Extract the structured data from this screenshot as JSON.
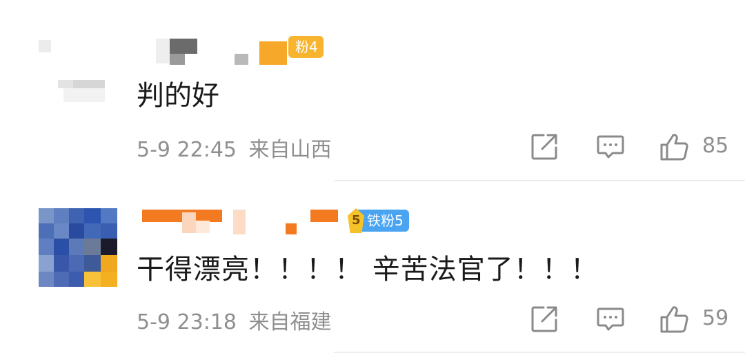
{
  "comments": [
    {
      "badge": "粉4",
      "text": "判的好",
      "date": "5-9 22:45",
      "location": "来自山西",
      "likes": "85",
      "icons": [
        "share-icon",
        "comment-icon",
        "like-icon"
      ]
    },
    {
      "badge": "铁粉5",
      "badge_icon_text": "5",
      "text": "干得漂亮！！！！ 辛苦法官了！！！",
      "date": "5-9 23:18",
      "location": "来自福建",
      "likes": "59",
      "icons": [
        "share-icon",
        "comment-icon",
        "like-icon"
      ]
    }
  ],
  "colors": {
    "badge_fan": "#f7b52f",
    "badge_iron_fan": "#4aa4f1",
    "meta_text": "#8f8f8f",
    "body_text": "#1a1a1a"
  }
}
